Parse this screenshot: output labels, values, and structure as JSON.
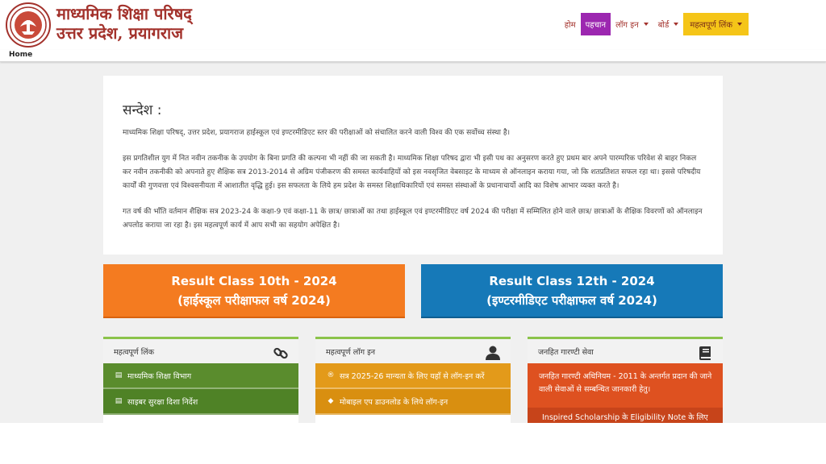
{
  "header": {
    "title_line1": "माध्यमिक शिक्षा परिषद्",
    "title_line2": "उत्तर प्रदेश, प्रयागराज",
    "logo_icon": "up-board-emblem-icon"
  },
  "nav": {
    "home": "होम",
    "identity": "पहचान",
    "login": "लॉग इन",
    "board": "बोर्ड",
    "important_links": "महत्वपूर्ण लिंक"
  },
  "breadcrumb": {
    "home": "Home"
  },
  "message": {
    "heading": "सन्देश :",
    "paragraphs": [
      "माध्यमिक शिक्षा परिषद्, उत्तर प्रदेश, प्रयागराज हाईस्कूल एवं इण्टरमीडिएट स्तर की परीक्षाओं को संचालित करने वाली विश्व की एक सर्वोच्च संस्था है।",
      "इस प्रगतिशील युग में नित नवीन तकनीक के उपयोग के बिना प्रगति की कल्पना भी नहीं की जा सकती है। माध्यमिक शिक्षा परिषद द्वारा भी इसी पथ का अनुसरण करते हुए प्रथम बार अपने पारम्परिक परिवेश से बाहर निकल कर नवीन तकनीकी को अपनाते हुए शैक्षिक सत्र 2013-2014 से अग्रिम पंजीकरण की समस्त कार्यवाहियों को इस नवसृजित वेबसाइट के माध्यम से ऑनलाइन कराया गया, जो कि शतप्रतिशत सफल रहा था। इससे परिषदीय कार्यों की गुणवत्ता एवं विश्वसनीयता में आशातीत वृद्धि हुई। इस सफलता के लिये हम प्रदेश के समस्त शिक्षाधिकारियों एवं समस्त संस्थाओं के प्रधानाचार्यो आदि का विशेष आभार व्यक्त करते है।",
      "गत वर्ष की भाँति वर्तमान शैक्षिक सत्र 2023-24 के कक्षा-9 एवं कक्षा-11 के छात्र/ छात्राओं का तथा हाईस्कूल एवं इण्टरमीडिएट वर्ष 2024 की परीक्षा में सम्मिलित होने वाले छात्र/ छात्राओं के शैक्षिक विवरणों को ऑनलाइन अपलोड कराया जा रहा है। इस महत्वपूर्ण कार्य में आप सभी का सहयोग अपेक्षित है।"
    ]
  },
  "results": {
    "class10_line1": "Result Class 10th - 2024",
    "class10_line2": "(हाईस्कूल परीक्षाफल वर्ष 2024)",
    "class12_line1": "Result Class 12th - 2024",
    "class12_line2": "(इण्टरमीडिएट परीक्षाफल वर्ष 2024)"
  },
  "panels": {
    "links": {
      "title": "महत्वपूर्ण लिंक",
      "icon": "link-icon",
      "items": [
        "माध्यमिक शिक्षा विभाग",
        "साइबर सुरक्षा दिशा निर्देश"
      ]
    },
    "logins": {
      "title": "महत्वपूर्ण लॉग इन",
      "icon": "user-icon",
      "items": [
        "सत्र 2025-26 मान्यता के लिए यहाँ से लॉग-इन करें",
        "मोबाइल एप डाउनलोड के लिये लॉग-इन"
      ]
    },
    "guarantee": {
      "title": "जनहित गारण्टी सेवा",
      "icon": "book-icon",
      "text": "जनहित गारण्टी अधिनियम - 2011 के अन्तर्गत प्रदान की जाने वाली सेवाओं से सम्बन्धित जानकारी हेतु।",
      "sub": "Inspired Scholarship के Eligibility Note के लिए"
    }
  },
  "colors": {
    "brand_red": "#a3322c",
    "active_nav": "#9c27b0",
    "yellow_nav": "#f5c518",
    "result10": "#f47b20",
    "result12": "#1679b8",
    "panel_green": "#5a8c2d",
    "panel_orange": "#e39a1a",
    "panel_red": "#de5120"
  }
}
